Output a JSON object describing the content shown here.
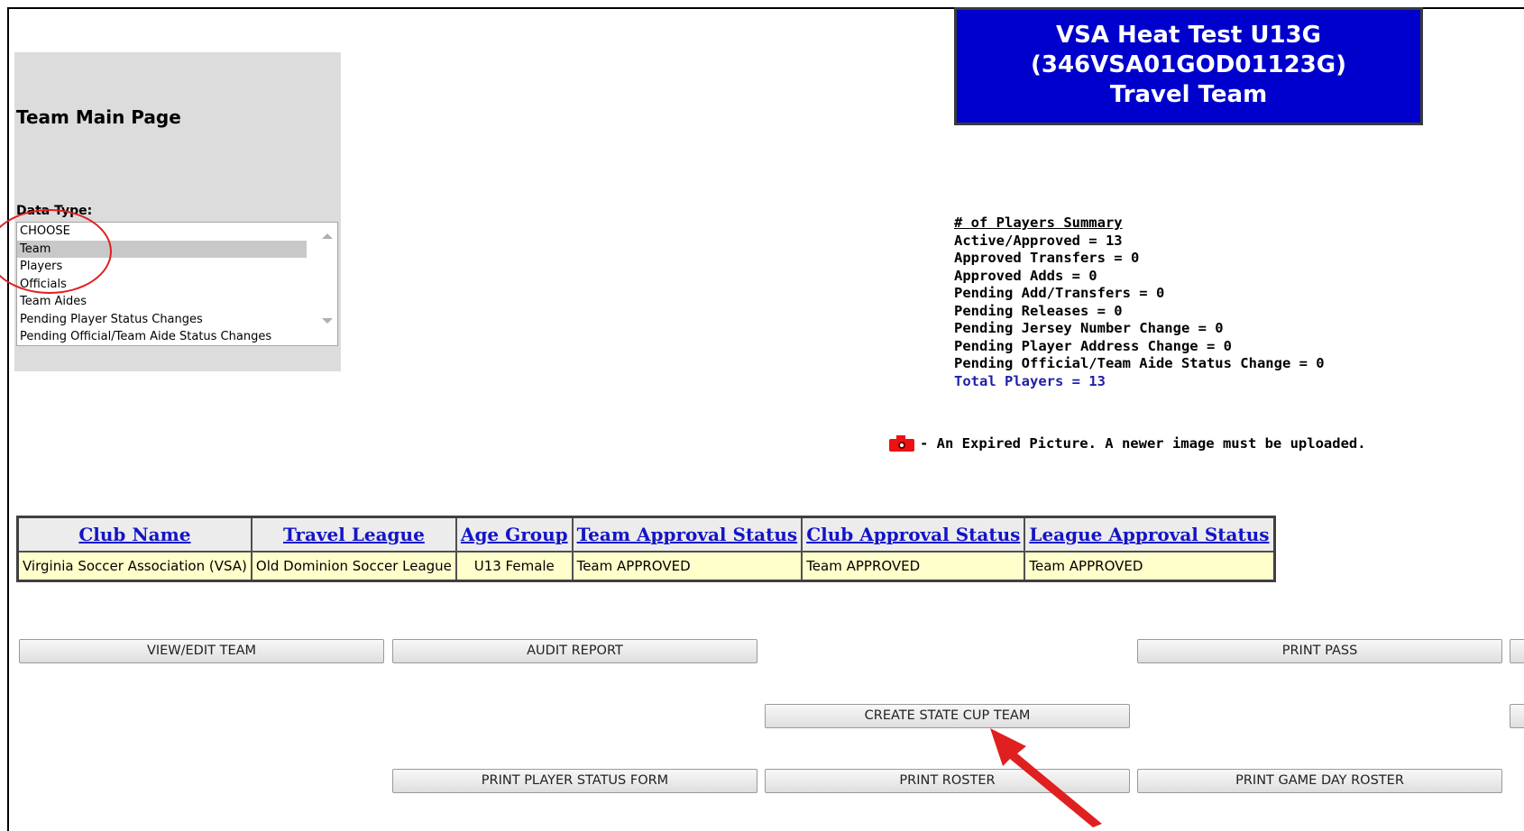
{
  "page": {
    "title": "Team Main Page",
    "data_type_label": "Data Type:"
  },
  "data_type_list": {
    "options": [
      "CHOOSE",
      "Team",
      "Players",
      "Officials",
      "Team Aides",
      "Pending Player Status Changes",
      "Pending Official/Team Aide Status Changes"
    ],
    "selected": "Team"
  },
  "team_header": {
    "line1": "VSA Heat Test U13G",
    "line2": "(346VSA01GOD01123G)",
    "line3": "Travel Team",
    "bg_color": "#0000cc"
  },
  "summary": {
    "heading": "# of Players Summary",
    "lines": [
      "Active/Approved = 13",
      "Approved Transfers = 0",
      "Approved Adds = 0",
      "Pending Add/Transfers = 0",
      "Pending Releases = 0",
      "Pending Jersey Number Change = 0",
      "Pending Player Address Change = 0",
      "Pending Official/Team Aide Status Change = 0"
    ],
    "total": "Total Players = 13"
  },
  "expired_note": {
    "icon": "camera-icon",
    "text": "- An Expired Picture. A newer image must be uploaded."
  },
  "info_table": {
    "headers": [
      "Club Name",
      "Travel League",
      "Age Group",
      "Team Approval Status",
      "Club Approval Status",
      "League Approval Status"
    ],
    "row": [
      "Virginia Soccer Association (VSA)",
      "Old Dominion Soccer League",
      "U13 Female",
      "Team APPROVED",
      "Team APPROVED",
      "Team APPROVED"
    ]
  },
  "buttons": {
    "view_edit_team": "VIEW/EDIT TEAM",
    "audit_report": "AUDIT REPORT",
    "print_pass": "PRINT PASS",
    "create_state_cup_team": "CREATE STATE CUP TEAM",
    "print_player_status_form": "PRINT PLAYER STATUS FORM",
    "print_roster": "PRINT ROSTER",
    "print_game_day_roster": "PRINT GAME DAY ROSTER"
  },
  "colors": {
    "link": "#1414c8",
    "table_row_bg": "#ffffcc",
    "annotation_red": "#e02020"
  }
}
